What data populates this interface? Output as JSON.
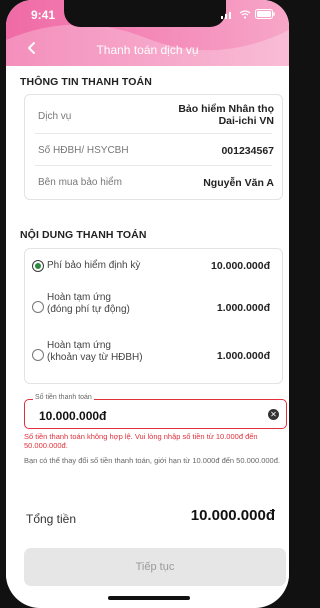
{
  "status_bar": {
    "time": "9:41"
  },
  "header": {
    "title": "Thanh toán dịch vụ"
  },
  "payment_info": {
    "section_title": "THÔNG TIN THANH TOÁN",
    "rows": [
      {
        "label": "Dịch vụ",
        "value": "Bảo hiểm Nhân thọ\nDai-ichi VN"
      },
      {
        "label": "Số HĐBH/ HSYCBH",
        "value": "001234567"
      },
      {
        "label": "Bên mua bảo hiểm",
        "value": "Nguyễn Văn A"
      }
    ]
  },
  "payment_content": {
    "section_title": "NỘI DUNG THANH TOÁN",
    "options": [
      {
        "label": "Phí bảo hiểm định kỳ",
        "amount": "10.000.000đ",
        "selected": true
      },
      {
        "label": "Hoàn tạm ứng\n(đóng phí tự động)",
        "amount": "1.000.000đ",
        "selected": false
      },
      {
        "label": "Hoàn tạm ứng\n(khoản vay từ HĐBH)",
        "amount": "1.000.000đ",
        "selected": false
      }
    ]
  },
  "amount_input": {
    "legend": "Số tiền thanh toán",
    "value": "10.000.000đ",
    "error": "Số tiền thanh toán không hợp lệ. Vui lòng nhập số tiền từ 10.000đ đến 50.000.000đ.",
    "hint": "Bạn có thể thay đổi số tiền thanh toán, giới hạn từ 10.000đ đến 50.000.000đ."
  },
  "total": {
    "label": "Tổng tiền",
    "value": "10.000.000đ"
  },
  "continue_button": {
    "label": "Tiếp tục"
  },
  "colors": {
    "brand": "#f06aa6",
    "error": "#e0303c",
    "radio_selected": "#2b8a3e"
  }
}
